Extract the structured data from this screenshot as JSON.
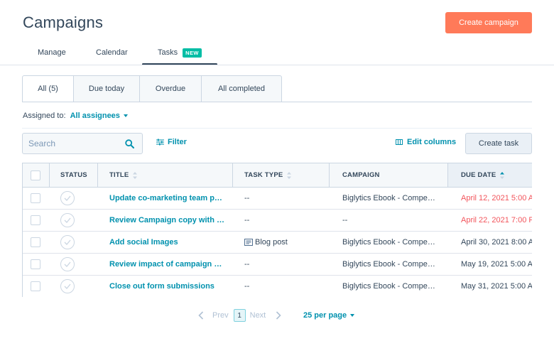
{
  "header": {
    "title": "Campaigns",
    "create_button": "Create campaign"
  },
  "top_tabs": [
    {
      "label": "Manage"
    },
    {
      "label": "Calendar"
    },
    {
      "label": "Tasks",
      "badge": "NEW"
    }
  ],
  "filter_tabs": [
    {
      "label": "All (5)"
    },
    {
      "label": "Due today"
    },
    {
      "label": "Overdue"
    },
    {
      "label": "All completed"
    }
  ],
  "assigned": {
    "label": "Assigned to:",
    "value": "All assignees"
  },
  "toolbar": {
    "search_placeholder": "Search",
    "filter_label": "Filter",
    "edit_columns_label": "Edit columns",
    "create_task_label": "Create task"
  },
  "table": {
    "columns": [
      "STATUS",
      "TITLE",
      "TASK TYPE",
      "CAMPAIGN",
      "DUE DATE"
    ],
    "rows": [
      {
        "title": "Update co-marketing team p…",
        "type": "--",
        "campaign": "Biglytics Ebook - Compe…",
        "due": "April 12, 2021 5:00 A",
        "overdue": true
      },
      {
        "title": "Review Campaign copy with …",
        "type": "--",
        "campaign": "--",
        "due": "April 22, 2021 7:00 P",
        "overdue": true
      },
      {
        "title": "Add social Images",
        "type": "Blog post",
        "campaign": "Biglytics Ebook - Compe…",
        "due": "April 30, 2021 8:00 A",
        "overdue": false
      },
      {
        "title": "Review impact of campaign …",
        "type": "--",
        "campaign": "Biglytics Ebook - Compe…",
        "due": "May 19, 2021 5:00 A",
        "overdue": false
      },
      {
        "title": "Close out form submissions",
        "type": "--",
        "campaign": "Biglytics Ebook - Compe…",
        "due": "May 31, 2021 5:00 A",
        "overdue": false
      }
    ]
  },
  "pagination": {
    "prev": "Prev",
    "current": "1",
    "next": "Next",
    "per_page": "25 per page"
  },
  "colors": {
    "accent": "#0091ae",
    "primary_button": "#ff7a59",
    "badge": "#00bda5",
    "overdue": "#f2545b"
  }
}
